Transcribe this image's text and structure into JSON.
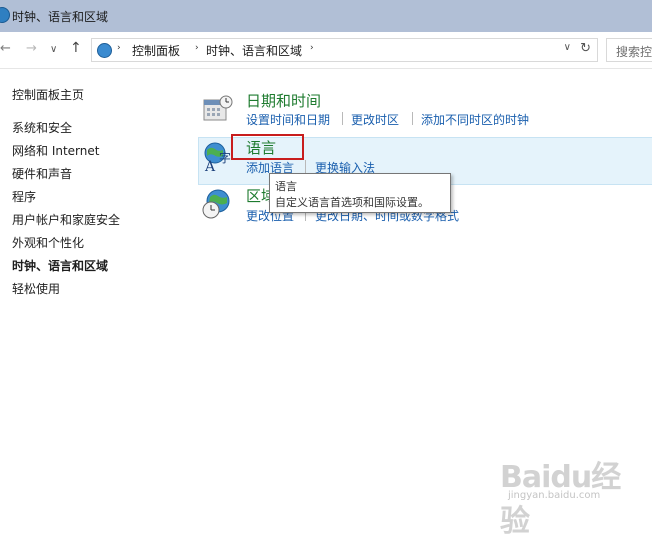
{
  "window": {
    "title": "时钟、语言和区域"
  },
  "nav": {
    "back": "←",
    "forward": "→",
    "recent": "∨",
    "up": "↑",
    "breadcrumbs": [
      "控制面板",
      "时钟、语言和区域"
    ],
    "breadcrumb_sep": "›",
    "dropdown": "∨",
    "refresh": "↻",
    "search_placeholder": "搜索控"
  },
  "sidebar": {
    "items": [
      {
        "label": "控制面板主页"
      },
      {
        "label": "系统和安全"
      },
      {
        "label": "网络和 Internet"
      },
      {
        "label": "硬件和声音"
      },
      {
        "label": "程序"
      },
      {
        "label": "用户帐户和家庭安全"
      },
      {
        "label": "外观和个性化"
      },
      {
        "label": "时钟、语言和区域",
        "current": true
      },
      {
        "label": "轻松使用"
      }
    ]
  },
  "categories": {
    "datetime": {
      "title": "日期和时间",
      "links": [
        "设置时间和日期",
        "更改时区",
        "添加不同时区的时钟"
      ]
    },
    "language": {
      "title": "语言",
      "links": [
        "添加语言",
        "更换输入法"
      ]
    },
    "region": {
      "title": "区域",
      "links": [
        "更改位置",
        "更改日期、时间或数字格式"
      ]
    }
  },
  "tooltip": {
    "title": "语言",
    "description": "自定义语言首选项和国际设置。"
  },
  "watermark": {
    "brand": "Baidu经验",
    "url": "jingyan.baidu.com"
  },
  "colors": {
    "category_title": "#1e7b2f",
    "link": "#1a5fae",
    "highlight": "#e5f3fb",
    "callout": "#c81d1d"
  }
}
